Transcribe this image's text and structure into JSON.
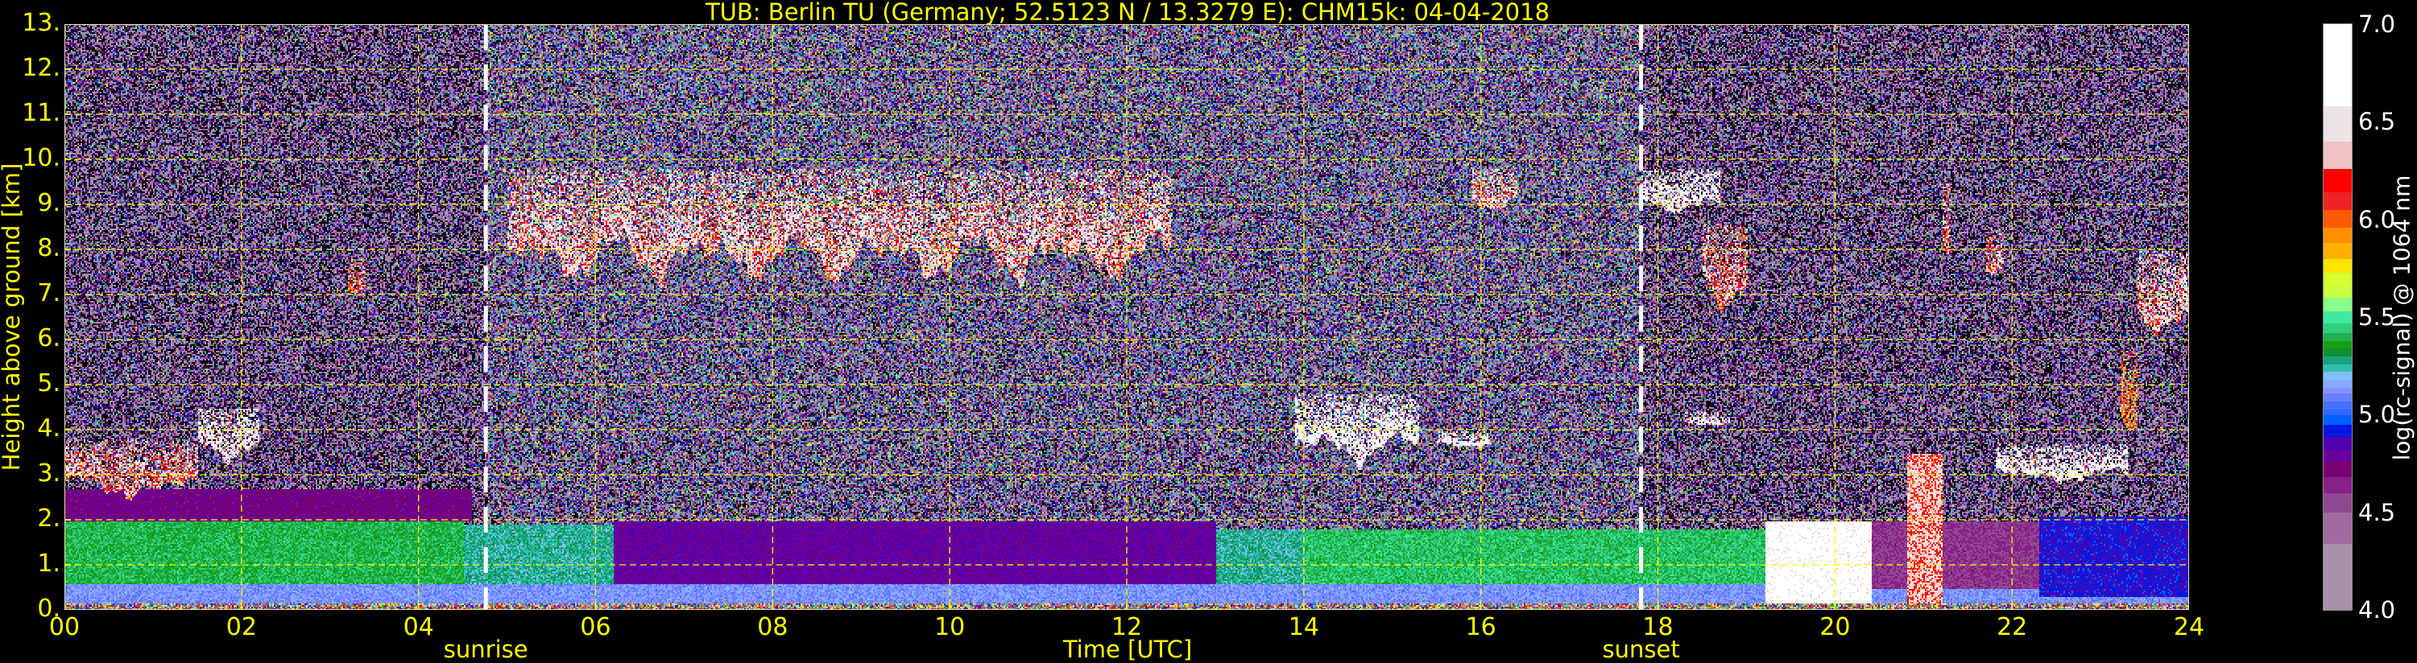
{
  "chart_data": {
    "type": "heatmap",
    "title": "TUB: Berlin TU (Germany; 52.5123 N / 13.3279 E):    CHM15k: 04-04-2018",
    "xlabel": "Time [UTC]",
    "ylabel": "Height above ground [km]",
    "xlim": [
      0,
      24
    ],
    "ylim": [
      0,
      13
    ],
    "x_ticks": [
      "00",
      "02",
      "04",
      "06",
      "08",
      "10",
      "12",
      "14",
      "16",
      "18",
      "20",
      "22",
      "24"
    ],
    "y_ticks": [
      "0.",
      "1.",
      "2.",
      "3.",
      "4.",
      "5.",
      "6.",
      "7.",
      "8.",
      "9.",
      "10.",
      "11.",
      "12.",
      "13."
    ],
    "grid": true,
    "grid_color": "#ffff00",
    "events": [
      {
        "label": "sunrise",
        "time": 4.76
      },
      {
        "label": "sunset",
        "time": 17.81
      }
    ],
    "colorbar": {
      "label": "log(rc-signal) @ 1064 nm",
      "range": [
        4.0,
        7.0
      ],
      "ticks": [
        "4.0",
        "4.5",
        "5.0",
        "5.5",
        "6.0",
        "6.5",
        "7.0"
      ],
      "levels": [
        {
          "from": 4.0,
          "to": 4.34,
          "color": "#a890a8"
        },
        {
          "from": 4.34,
          "to": 4.5,
          "color": "#a06ca0"
        },
        {
          "from": 4.5,
          "to": 4.6,
          "color": "#904890"
        },
        {
          "from": 4.6,
          "to": 4.68,
          "color": "#882088"
        },
        {
          "from": 4.68,
          "to": 4.76,
          "color": "#780070"
        },
        {
          "from": 4.76,
          "to": 4.82,
          "color": "#6a00a0"
        },
        {
          "from": 4.82,
          "to": 4.89,
          "color": "#5000b0"
        },
        {
          "from": 4.89,
          "to": 4.95,
          "color": "#0018e0"
        },
        {
          "from": 4.95,
          "to": 5.0,
          "color": "#0060ff"
        },
        {
          "from": 5.0,
          "to": 5.03,
          "color": "#3068ff"
        },
        {
          "from": 5.03,
          "to": 5.07,
          "color": "#4a70ff"
        },
        {
          "from": 5.07,
          "to": 5.11,
          "color": "#6a80ff"
        },
        {
          "from": 5.11,
          "to": 5.14,
          "color": "#8890ff"
        },
        {
          "from": 5.14,
          "to": 5.18,
          "color": "#88aaff"
        },
        {
          "from": 5.18,
          "to": 5.22,
          "color": "#80c0ff"
        },
        {
          "from": 5.22,
          "to": 5.26,
          "color": "#30c0b0"
        },
        {
          "from": 5.26,
          "to": 5.3,
          "color": "#18a080"
        },
        {
          "from": 5.3,
          "to": 5.34,
          "color": "#109030"
        },
        {
          "from": 5.34,
          "to": 5.38,
          "color": "#18a010"
        },
        {
          "from": 5.38,
          "to": 5.42,
          "color": "#20b050"
        },
        {
          "from": 5.42,
          "to": 5.47,
          "color": "#30d080"
        },
        {
          "from": 5.47,
          "to": 5.53,
          "color": "#40e8a0"
        },
        {
          "from": 5.53,
          "to": 5.6,
          "color": "#88ff88"
        },
        {
          "from": 5.6,
          "to": 5.66,
          "color": "#c8ff40"
        },
        {
          "from": 5.66,
          "to": 5.73,
          "color": "#d8ff30"
        },
        {
          "from": 5.73,
          "to": 5.8,
          "color": "#ffe600"
        },
        {
          "from": 5.8,
          "to": 5.88,
          "color": "#ffb000"
        },
        {
          "from": 5.88,
          "to": 5.96,
          "color": "#ff9000"
        },
        {
          "from": 5.96,
          "to": 6.05,
          "color": "#ff5a00"
        },
        {
          "from": 6.05,
          "to": 6.14,
          "color": "#f02424"
        },
        {
          "from": 6.14,
          "to": 6.26,
          "color": "#ff0000"
        },
        {
          "from": 6.26,
          "to": 6.4,
          "color": "#f0c4c4"
        },
        {
          "from": 6.4,
          "to": 6.58,
          "color": "#ece4e4"
        },
        {
          "from": 6.58,
          "to": 7.0,
          "color": "#ffffff"
        }
      ]
    },
    "features": [
      {
        "kind": "surface-layer",
        "t": [
          0,
          24
        ],
        "h": [
          0.15,
          0.6
        ],
        "value": 5.12
      },
      {
        "kind": "boundary-layer",
        "t": [
          0,
          4.5
        ],
        "h": [
          0.6,
          2.0
        ],
        "value": 5.4
      },
      {
        "kind": "boundary-layer",
        "t": [
          4.5,
          6.2
        ],
        "h": [
          0.6,
          1.9
        ],
        "value": 5.26
      },
      {
        "kind": "boundary-layer",
        "t": [
          6.2,
          13.0
        ],
        "h": [
          0.6,
          2.0
        ],
        "value": 4.8
      },
      {
        "kind": "boundary-layer",
        "t": [
          13.0,
          14.0
        ],
        "h": [
          0.6,
          1.8
        ],
        "value": 5.26
      },
      {
        "kind": "boundary-layer",
        "t": [
          14.0,
          19.2
        ],
        "h": [
          0.6,
          1.8
        ],
        "value": 5.42
      },
      {
        "kind": "boundary-layer",
        "t": [
          20.4,
          22.3
        ],
        "h": [
          0.5,
          2.0
        ],
        "value": 4.6
      },
      {
        "kind": "boundary-layer",
        "t": [
          22.3,
          24
        ],
        "h": [
          0.3,
          2.1
        ],
        "value": 4.9
      },
      {
        "kind": "residual-layer",
        "t": [
          0,
          4.6
        ],
        "h": [
          2.0,
          2.7
        ],
        "value": 4.75
      },
      {
        "kind": "cloud",
        "t": [
          0,
          1.5
        ],
        "h": [
          2.0,
          3.8
        ],
        "value": 6.3
      },
      {
        "kind": "cloud",
        "t": [
          1.5,
          2.2
        ],
        "h": [
          3.0,
          4.5
        ],
        "value": 6.6
      },
      {
        "kind": "cloud",
        "t": [
          3.2,
          3.4
        ],
        "h": [
          6.8,
          7.8
        ],
        "value": 6.2
      },
      {
        "kind": "cloud",
        "t": [
          5.0,
          12.5
        ],
        "h": [
          6.5,
          9.8
        ],
        "value": 6.4
      },
      {
        "kind": "cloud",
        "t": [
          13.9,
          15.3
        ],
        "h": [
          2.8,
          4.8
        ],
        "value": 6.8
      },
      {
        "kind": "cloud",
        "t": [
          15.5,
          16.1
        ],
        "h": [
          3.5,
          4.0
        ],
        "value": 6.7
      },
      {
        "kind": "cloud",
        "t": [
          15.9,
          16.4
        ],
        "h": [
          8.6,
          9.8
        ],
        "value": 6.4
      },
      {
        "kind": "cloud",
        "t": [
          17.8,
          18.7
        ],
        "h": [
          8.5,
          9.8
        ],
        "value": 6.7
      },
      {
        "kind": "cloud",
        "t": [
          18.5,
          19.0
        ],
        "h": [
          6.2,
          8.6
        ],
        "value": 6.3
      },
      {
        "kind": "cloud",
        "t": [
          18.3,
          18.8
        ],
        "h": [
          4.0,
          4.4
        ],
        "value": 6.6
      },
      {
        "kind": "precipitation",
        "t": [
          19.2,
          20.4
        ],
        "h": [
          0,
          2.0
        ],
        "value": 6.8
      },
      {
        "kind": "precipitation",
        "t": [
          20.8,
          21.2
        ],
        "h": [
          0,
          3.5
        ],
        "value": 6.3
      },
      {
        "kind": "cloud",
        "t": [
          21.2,
          21.3
        ],
        "h": [
          7.3,
          9.5
        ],
        "value": 6.2
      },
      {
        "kind": "cloud",
        "t": [
          21.7,
          21.9
        ],
        "h": [
          7.0,
          8.5
        ],
        "value": 6.2
      },
      {
        "kind": "cloud",
        "t": [
          21.8,
          23.3
        ],
        "h": [
          2.5,
          3.7
        ],
        "value": 6.7
      },
      {
        "kind": "cloud",
        "t": [
          23.2,
          23.4
        ],
        "h": [
          3.5,
          5.8
        ],
        "value": 6.0
      },
      {
        "kind": "cloud",
        "t": [
          23.4,
          24
        ],
        "h": [
          5.5,
          8.0
        ],
        "value": 6.4
      }
    ]
  }
}
